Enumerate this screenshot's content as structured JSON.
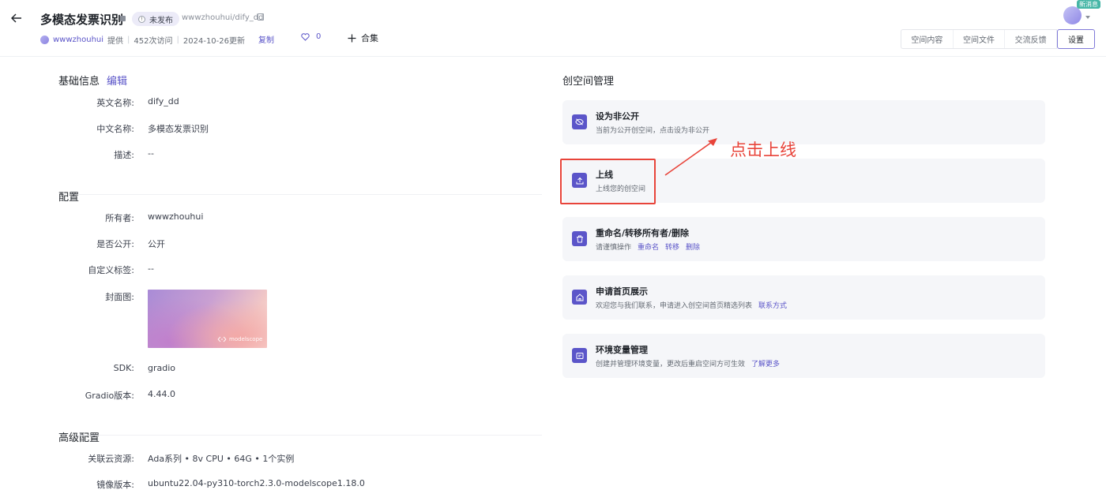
{
  "header": {
    "title": "多模态发票识别",
    "status": "未发布",
    "repo_path": "wwwzhouhui/dify_dd",
    "owner": "wwwzhouhui",
    "provided_by": "提供",
    "visits": "452次访问",
    "updated": "2024-10-26更新",
    "copy_label": "复制",
    "likes": "0",
    "collection_label": "合集",
    "new_message_badge": "新消息",
    "tabs": [
      "空间内容",
      "空间文件",
      "交流反馈"
    ],
    "active_tab": "设置"
  },
  "basic_info": {
    "title": "基础信息",
    "edit_label": "编辑",
    "rows": [
      {
        "label": "英文名称:",
        "value": "dify_dd"
      },
      {
        "label": "中文名称:",
        "value": "多模态发票识别"
      },
      {
        "label": "描述:",
        "value": "--"
      }
    ]
  },
  "config": {
    "title": "配置",
    "rows": [
      {
        "label": "所有者:",
        "value": "wwwzhouhui"
      },
      {
        "label": "是否公开:",
        "value": "公开"
      },
      {
        "label": "自定义标签:",
        "value": "--"
      },
      {
        "label": "封面图:",
        "value": ""
      },
      {
        "label": "SDK:",
        "value": "gradio"
      },
      {
        "label": "Gradio版本:",
        "value": "4.44.0"
      }
    ],
    "cover_logo_text": "modelscope"
  },
  "advanced": {
    "title": "高级配置",
    "rows": [
      {
        "label": "关联云资源:",
        "value": "Ada系列 • 8v CPU • 64G • 1个实例"
      },
      {
        "label": "镜像版本:",
        "value": "ubuntu22.04-py310-torch2.3.0-modelscope1.18.0"
      }
    ]
  },
  "management": {
    "title": "创空间管理",
    "cards": [
      {
        "icon": "eye-off-icon",
        "title": "设为非公开",
        "desc": "当前为公开创空间，点击设为非公开",
        "links": []
      },
      {
        "icon": "upload-icon",
        "title": "上线",
        "desc": "上线您的创空间",
        "links": []
      },
      {
        "icon": "trash-icon",
        "title": "重命名/转移所有者/删除",
        "desc": "请谨慎操作",
        "links": [
          "重命名",
          "转移",
          "删除"
        ]
      },
      {
        "icon": "home-icon",
        "title": "申请首页展示",
        "desc": "欢迎您与我们联系，申请进入创空间首页精选列表",
        "links": [
          "联系方式"
        ]
      },
      {
        "icon": "env-icon",
        "title": "环境变量管理",
        "desc": "创建并管理环境变量，更改后重启空间方可生效",
        "links": [
          "了解更多"
        ]
      }
    ]
  },
  "annotation": {
    "text": "点击上线",
    "color": "#e8443a"
  },
  "colors": {
    "accent": "#5b55c9",
    "link": "#5a54c8",
    "card_bg": "#f5f6f9"
  }
}
